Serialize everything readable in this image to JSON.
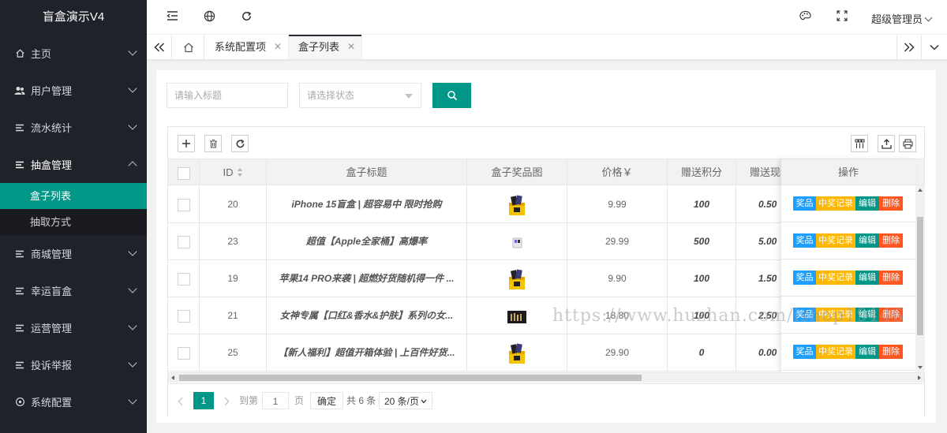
{
  "app_title": "盲盒演示V4",
  "sidebar": {
    "items": [
      {
        "label": "主页",
        "icon": "home-icon",
        "glyph": "⌂"
      },
      {
        "label": "用户管理",
        "icon": "users-icon",
        "glyph": "👥"
      },
      {
        "label": "流水统计",
        "icon": "list-icon",
        "glyph": "☰"
      },
      {
        "label": "抽盒管理",
        "icon": "list-icon",
        "glyph": "☰",
        "expanded": true
      },
      {
        "label": "商城管理",
        "icon": "list-icon",
        "glyph": "☰"
      },
      {
        "label": "幸运盲盒",
        "icon": "list-icon",
        "glyph": "☰"
      },
      {
        "label": "运营管理",
        "icon": "list-icon",
        "glyph": "☰"
      },
      {
        "label": "投诉举报",
        "icon": "list-icon",
        "glyph": "☰"
      },
      {
        "label": "系统配置",
        "icon": "settings-icon",
        "glyph": "⚙"
      }
    ],
    "submenu": [
      {
        "label": "盒子列表",
        "active": true
      },
      {
        "label": "抽取方式",
        "active": false
      }
    ]
  },
  "header": {
    "user": "超级管理员"
  },
  "tabs": [
    {
      "label": "系统配置项",
      "active": false
    },
    {
      "label": "盒子列表",
      "active": true
    }
  ],
  "search": {
    "title_placeholder": "请输入标题",
    "status_placeholder": "请选择状态"
  },
  "table": {
    "columns": {
      "id": "ID",
      "title": "盒子标题",
      "image": "盒子奖品图",
      "price": "价格￥",
      "points": "赠送积分",
      "cash": "赠送现金",
      "ops": "操作"
    },
    "rows": [
      {
        "id": "20",
        "title": "iPhone 15盲盒 | 超容易中 限时抢购",
        "price": "9.99",
        "points": "100",
        "cash": "0.50",
        "img": "box"
      },
      {
        "id": "23",
        "title": "超值【Apple全家桶】高爆率",
        "price": "29.99",
        "points": "500",
        "cash": "5.00",
        "img": "small"
      },
      {
        "id": "19",
        "title": "苹果14 PRO来袭 | 超燃好货随机得一件 ...",
        "price": "9.90",
        "points": "100",
        "cash": "1.50",
        "img": "box"
      },
      {
        "id": "21",
        "title": "女神专属【口红&香水&护肤】系列の女...",
        "price": "18.80",
        "points": "100",
        "cash": "2.50",
        "img": "dark"
      },
      {
        "id": "25",
        "title": "【新人福利】超值开箱体验 | 上百件好货...",
        "price": "29.90",
        "points": "0",
        "cash": "0.00",
        "img": "box"
      }
    ],
    "actions": {
      "prize": "奖品",
      "records": "中奖记录",
      "edit": "编辑",
      "delete": "删除"
    }
  },
  "pager": {
    "current": "1",
    "goto_label": "到第",
    "goto_value": "1",
    "page_unit": "页",
    "confirm": "确定",
    "total": "共 6 条",
    "page_size": "20 条/页"
  },
  "watermark": "https://www.huzhan.com/ishop19146",
  "colors": {
    "sidebar_bg": "#20222a",
    "accent": "#009688",
    "blue": "#1e9fff",
    "orange": "#ffb800",
    "red": "#ff5722"
  }
}
